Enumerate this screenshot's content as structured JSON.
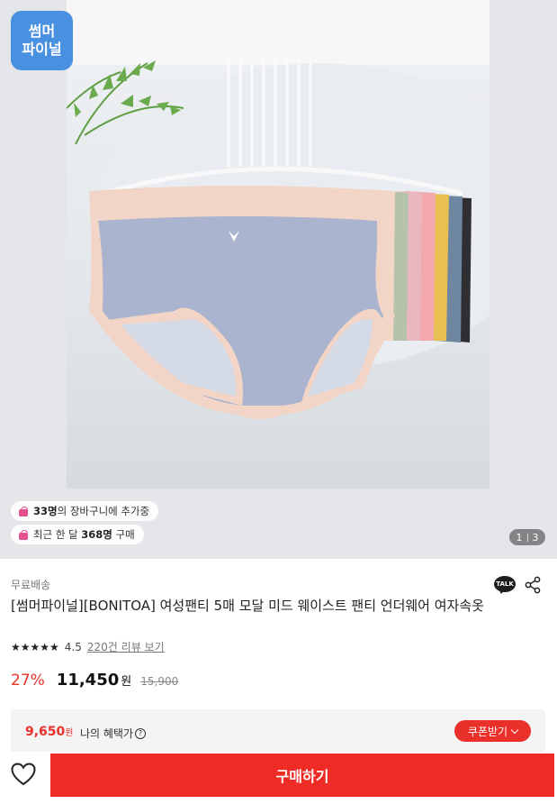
{
  "gallery": {
    "seller_logo_line1": "썸머",
    "seller_logo_line2": "파이널",
    "cart_count": "33명",
    "cart_suffix": "의 장바구니에 추가중",
    "purchase_prefix": "최근 한 달 ",
    "purchase_count": "368명",
    "purchase_suffix": " 구매",
    "current_page": "1",
    "total_pages": "3",
    "accent_color": "#e5508f"
  },
  "product": {
    "shipping": "무료배송",
    "title": "[썸머파이널][BONITOA] 여성팬티 5매 모달 미드 웨이스트 팬티 언더웨어 여자속옷",
    "stars": "★★★★★",
    "rating": "4.5",
    "review_link": "220건 리뷰 보기",
    "discount": "27%",
    "price": "11,450",
    "currency": "원",
    "original_price": "15,900"
  },
  "benefit": {
    "price": "9,650",
    "currency": "원",
    "label": "나의 혜택가",
    "help_icon": "?",
    "coupon_button": "쿠폰받기"
  },
  "actions": {
    "talk_label": "TALK",
    "buy_button": "구매하기"
  },
  "colors": {
    "brand_red": "#e9302a",
    "logo_blue": "#4a90e0"
  }
}
